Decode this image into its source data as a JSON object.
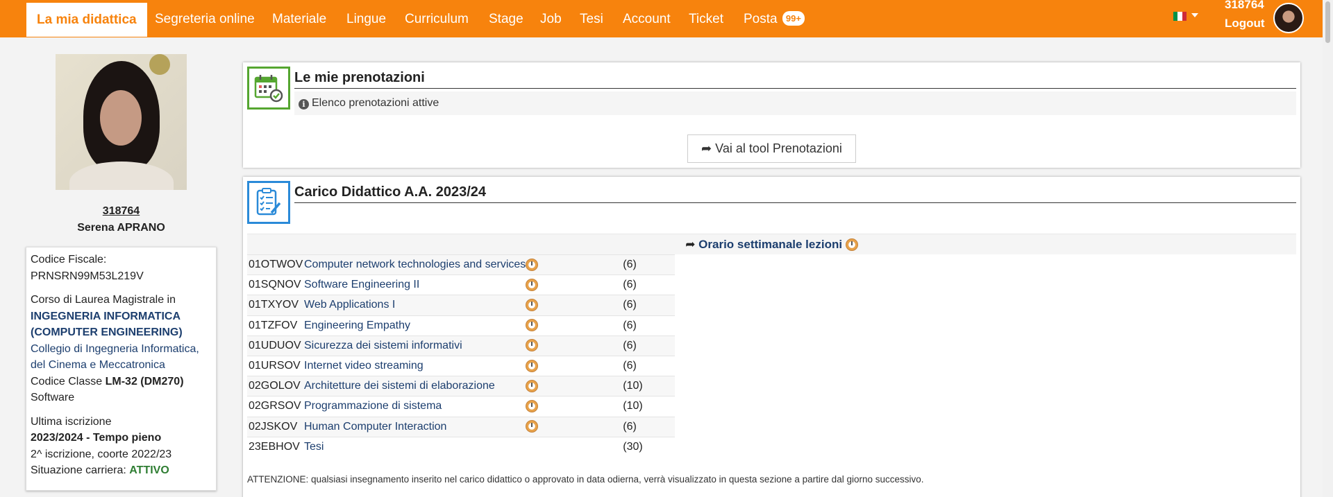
{
  "nav": {
    "items": [
      "La mia didattica",
      "Segreteria online",
      "Materiale",
      "Lingue",
      "Curriculum",
      "Stage",
      "Job",
      "Tesi",
      "Account",
      "Ticket",
      "Posta"
    ],
    "mail_badge": "99+",
    "user_id": "318764",
    "logout": "Logout",
    "flag_icon": "italy-flag-icon"
  },
  "profile": {
    "matricola": "318764",
    "name": "Serena APRANO",
    "codice_fiscale_label": "Codice Fiscale:",
    "codice_fiscale": "PRNSRN99M53L219V",
    "corso_label": "Corso di Laurea Magistrale in",
    "corso_line1": "INGEGNERIA INFORMATICA",
    "corso_line2": "(COMPUTER ENGINEERING)",
    "collegio_line1": "Collegio di Ingegneria Informatica,",
    "collegio_line2": "del Cinema e Meccatronica",
    "classe_label": "Codice Classe",
    "classe_value": "LM-32 (DM270)",
    "classe_extra": "Software",
    "iscrizione_label": "Ultima iscrizione",
    "iscrizione_value": "2023/2024 - Tempo pieno",
    "coorte": "2^ iscrizione, coorte 2022/23",
    "carriera_label": "Situazione carriera:",
    "carriera_value": "ATTIVO"
  },
  "prenotazioni": {
    "title": "Le mie prenotazioni",
    "subtitle": "Elenco prenotazioni attive",
    "button": "Vai al tool Prenotazioni"
  },
  "carico": {
    "title": "Carico Didattico A.A. 2023/24",
    "orario_link": "Orario settimanale lezioni",
    "courses": [
      {
        "code": "01OTWOV",
        "name": "Computer network technologies and services",
        "cfu": "(6)",
        "clock": true
      },
      {
        "code": "01SQNOV",
        "name": "Software Engineering II",
        "cfu": "(6)",
        "clock": true
      },
      {
        "code": "01TXYOV",
        "name": "Web Applications I",
        "cfu": "(6)",
        "clock": true
      },
      {
        "code": "01TZFOV",
        "name": "Engineering Empathy",
        "cfu": "(6)",
        "clock": true
      },
      {
        "code": "01UDUOV",
        "name": "Sicurezza dei sistemi informativi",
        "cfu": "(6)",
        "clock": true
      },
      {
        "code": "01URSOV",
        "name": "Internet video streaming",
        "cfu": "(6)",
        "clock": true
      },
      {
        "code": "02GOLOV",
        "name": "Architetture dei sistemi di elaborazione",
        "cfu": "(10)",
        "clock": true
      },
      {
        "code": "02GRSOV",
        "name": "Programmazione di sistema",
        "cfu": "(10)",
        "clock": true
      },
      {
        "code": "02JSKOV",
        "name": "Human Computer Interaction",
        "cfu": "(6)",
        "clock": true
      },
      {
        "code": "23EBHOV",
        "name": "Tesi",
        "cfu": "(30)",
        "clock": false
      }
    ],
    "note": "ATTENZIONE: qualsiasi insegnamento inserito nel carico didattico o approvato in data odierna, verrà visualizzato in questa sezione a partire dal giorno successivo."
  }
}
